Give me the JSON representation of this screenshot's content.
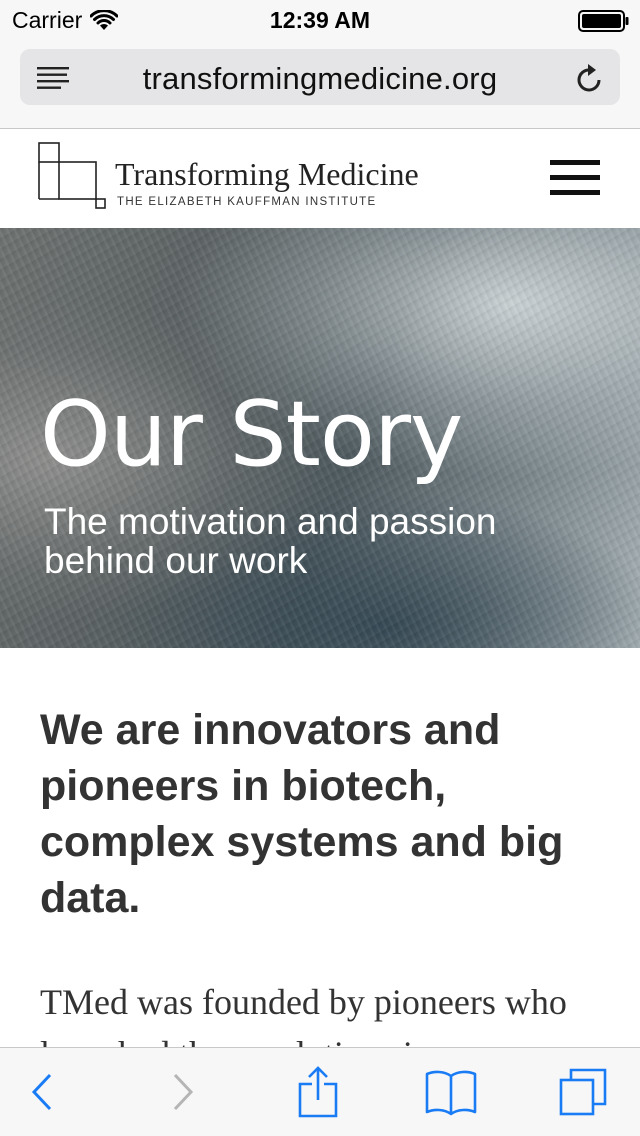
{
  "status_bar": {
    "carrier": "Carrier",
    "time": "12:39 AM"
  },
  "browser": {
    "url": "transformingmedicine.org"
  },
  "site": {
    "logo_title": "Transforming Medicine",
    "logo_subtitle": "THE ELIZABETH KAUFFMAN INSTITUTE"
  },
  "hero": {
    "title": "Our Story",
    "subtitle": "The motivation and passion behind our work"
  },
  "content": {
    "heading": "We are innovators and pioneers in biotech, complex systems and big data.",
    "body": "TMed was founded by pioneers who launched the revolutions in"
  },
  "colors": {
    "ios_blue": "#1a7cf5",
    "disabled_gray": "#b5b5b5",
    "text_dark": "#333333"
  },
  "icons": {
    "wifi": "wifi-icon",
    "battery": "battery-icon",
    "reader": "reader-list-icon",
    "reload": "reload-icon",
    "menu": "hamburger-menu-icon",
    "back": "back-chevron-icon",
    "forward": "forward-chevron-icon",
    "share": "share-icon",
    "bookmarks": "bookmarks-icon",
    "tabs": "tabs-icon"
  }
}
